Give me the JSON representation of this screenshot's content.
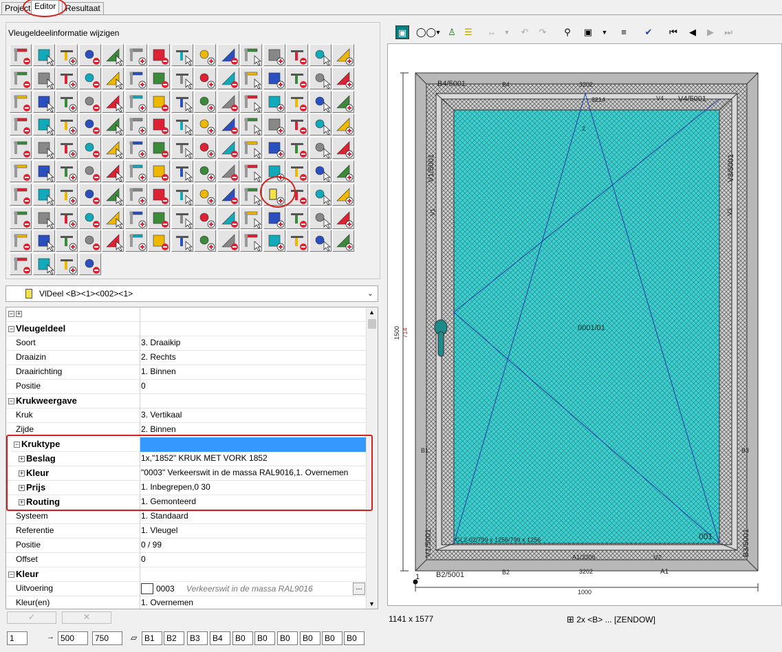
{
  "tabs": [
    "Project",
    "Editor",
    "Resultaat"
  ],
  "panel_title": "Vleugeldeelinformatie wijzigen",
  "dropdown": {
    "value": "VlDeel <B><1><002><1>"
  },
  "props": {
    "vleugeldeel": "Vleugeldeel",
    "soort": [
      "Soort",
      "3. Draaikip"
    ],
    "draaizin": [
      "Draaizin",
      "2. Rechts"
    ],
    "draairichting": [
      "Draairichting",
      "1. Binnen"
    ],
    "positie1": [
      "Positie",
      "0"
    ],
    "krukweergave": "Krukweergave",
    "kruk": [
      "Kruk",
      "3. Vertikaal"
    ],
    "zijde": [
      "Zijde",
      "2. Binnen"
    ],
    "kruktype": "Kruktype",
    "beslag": [
      "Beslag",
      "1x,\"1852\" KRUK MET VORK 1852"
    ],
    "kleur_sub": [
      "Kleur",
      "\"0003\" Verkeerswit in de massa RAL9016,1. Overnemen"
    ],
    "prijs": [
      "Prijs",
      "1. Inbegrepen,0 30"
    ],
    "routing": [
      "Routing",
      "1. Gemonteerd"
    ],
    "systeem": [
      "Systeem",
      "1. Standaard"
    ],
    "referentie": [
      "Referentie",
      "1. Vleugel"
    ],
    "positie2": [
      "Positie",
      "0 / 99"
    ],
    "offset": [
      "Offset",
      "0"
    ],
    "kleur_cat": "Kleur",
    "uitvoering": [
      "Uitvoering",
      "0003",
      "Verkeerswit in de massa RAL9016",
      "..."
    ],
    "kleuren": [
      "Kleur(en)",
      "1. Overnemen"
    ]
  },
  "bottom_fields": [
    "1",
    "500",
    "750",
    "B1",
    "B2",
    "B3",
    "B4",
    "B0",
    "B0",
    "B0",
    "B0",
    "B0",
    "B0"
  ],
  "drawing": {
    "top_labels": [
      "B4/5001",
      "B4",
      "3202",
      "V4",
      "V4/5001"
    ],
    "inner_top": "3214",
    "label_2": "2",
    "left_labels": [
      "V1/5001",
      "V1",
      "B1",
      "V1/5001"
    ],
    "right_labels": [
      "V3/5001",
      "V3",
      "B3",
      "B3/5001"
    ],
    "center": "0001/01",
    "height_dim": "1500",
    "kruk_dim": "714",
    "bottom_note": "GL2-02/799 x 1256/799 x 1256",
    "sash_id": "001",
    "bottom_inner": [
      "A1/3306",
      "V2"
    ],
    "bottom_outer": [
      "B2/5001",
      "B2",
      "3202",
      "A1"
    ],
    "width_dim": "1000",
    "corner": "1",
    "glass_color": "#3ecfcf",
    "frame_color": "#b8b8b8"
  },
  "status": {
    "size": "1141 x 1577",
    "info": "2x <B> ... [ZENDOW]"
  }
}
